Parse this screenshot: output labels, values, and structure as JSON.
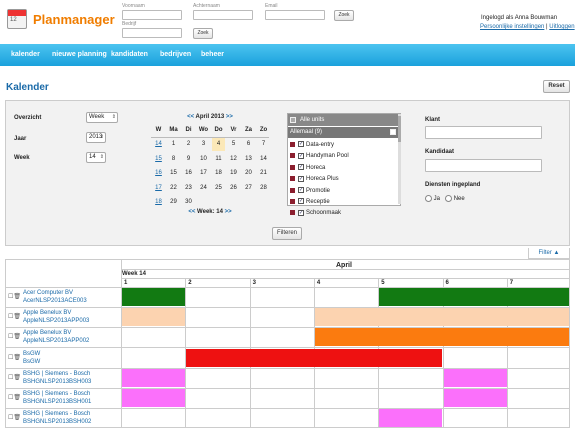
{
  "header": {
    "calendar_day": "12",
    "brand": "Planmanager",
    "search": {
      "voornaam_label": "Voornaam",
      "achternaam_label": "Achternaam",
      "email_label": "Email",
      "bedrijf_label": "Bedrijf",
      "zoek_label": "Zoek"
    },
    "user": {
      "logged_in": "Ingelogd als Anna Bouwman",
      "settings_link": "Persoonlijke instellingen",
      "separator": "|",
      "logout_link": "Uitloggen"
    }
  },
  "nav": {
    "items": [
      "kalender",
      "nieuwe planning",
      "kandidaten",
      "bedrijven",
      "beheer"
    ]
  },
  "page": {
    "title": "Kalender",
    "reset_label": "Reset"
  },
  "filters": {
    "overzicht_label": "Overzicht",
    "overzicht_value": "Week",
    "jaar_label": "Jaar",
    "jaar_value": "2013",
    "week_label": "Week",
    "week_value": "14",
    "klant_label": "Klant",
    "kandidaat_label": "Kandidaat",
    "diensten_label": "Diensten ingepland",
    "ja_label": "Ja",
    "nee_label": "Nee",
    "filteren_label": "Filteren",
    "filter_tab": "Filter ▲"
  },
  "calendar": {
    "prev": "<<",
    "month": "April 2013",
    "next": ">>",
    "headers": [
      "W",
      "Ma",
      "Di",
      "Wo",
      "Do",
      "Vr",
      "Za",
      "Zo"
    ],
    "weeks": [
      {
        "w": "14",
        "days": [
          "1",
          "2",
          "3",
          "4",
          "5",
          "6",
          "7"
        ]
      },
      {
        "w": "15",
        "days": [
          "8",
          "9",
          "10",
          "11",
          "12",
          "13",
          "14"
        ]
      },
      {
        "w": "16",
        "days": [
          "15",
          "16",
          "17",
          "18",
          "19",
          "20",
          "21"
        ]
      },
      {
        "w": "17",
        "days": [
          "22",
          "23",
          "24",
          "25",
          "26",
          "27",
          "28"
        ]
      },
      {
        "w": "18",
        "days": [
          "29",
          "30",
          "",
          "",
          "",
          "",
          ""
        ]
      }
    ],
    "today": "4",
    "footer_prev": "<<",
    "footer_week": "Week: 14",
    "footer_next": ">>"
  },
  "units": {
    "all_label": "Alle units",
    "group_label": "Allemaal (9)",
    "items": [
      "Data-entry",
      "Handyman Pool",
      "Horeca",
      "Horeca Plus",
      "Promotie",
      "Receptie",
      "Schoonmaak"
    ],
    "swatch_color": "#8b1e2e"
  },
  "grid": {
    "month": "April",
    "week": "Week 14",
    "days": [
      "1",
      "2",
      "3",
      "4",
      "5",
      "6",
      "7"
    ],
    "rows": [
      {
        "company": "Acer Computer BV",
        "code": "AcerNLSP2013ACE003",
        "color": "#127a12",
        "spans": [
          [
            0,
            1
          ],
          [
            4,
            7
          ]
        ]
      },
      {
        "company": "Apple Benelux BV",
        "code": "AppleNLSP2013APP003",
        "color": "#fcd3b0",
        "spans": [
          [
            0,
            1
          ],
          [
            3,
            7
          ]
        ]
      },
      {
        "company": "Apple Benelux BV",
        "code": "AppleNLSP2013APP002",
        "color": "#fb7b0f",
        "spans": [
          [
            3,
            7
          ]
        ]
      },
      {
        "company": "BsGW",
        "code": "BsGW",
        "color": "#ee1111",
        "spans": [
          [
            1,
            5
          ]
        ]
      },
      {
        "company": "BSHG | Siemens - Bosch",
        "code": "BSHGNLSP2013BSH003",
        "color": "#fb70fb",
        "spans": [
          [
            0,
            1
          ],
          [
            5,
            6
          ]
        ]
      },
      {
        "company": "BSHG | Siemens - Bosch",
        "code": "BSHGNLSP2013BSH001",
        "color": "#fb70fb",
        "spans": [
          [
            0,
            1
          ],
          [
            5,
            6
          ]
        ]
      },
      {
        "company": "BSHG | Siemens - Bosch",
        "code": "BSHGNLSP2013BSH002",
        "color": "#fb70fb",
        "spans": [
          [
            4,
            5
          ]
        ]
      }
    ]
  }
}
